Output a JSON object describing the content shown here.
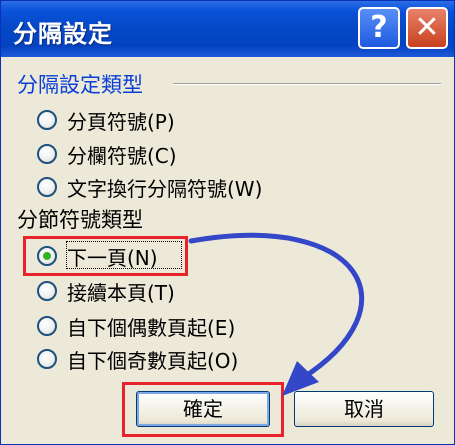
{
  "window": {
    "title": "分隔設定",
    "help_label": "?",
    "close_label": "✕"
  },
  "group_break": {
    "heading": "分隔設定類型",
    "options": [
      {
        "label": "分頁符號(P)"
      },
      {
        "label": "分欄符號(C)"
      },
      {
        "label": "文字換行分隔符號(W)"
      }
    ]
  },
  "group_section": {
    "heading": "分節符號類型",
    "options": [
      {
        "label": "下一頁(N)",
        "checked": true
      },
      {
        "label": "接續本頁(T)"
      },
      {
        "label": "自下個偶數頁起(E)"
      },
      {
        "label": "自下個奇數頁起(O)"
      }
    ]
  },
  "buttons": {
    "ok": "確定",
    "cancel": "取消"
  },
  "annotation_colors": {
    "highlight": "#e8232a",
    "arrow": "#3347c8"
  }
}
